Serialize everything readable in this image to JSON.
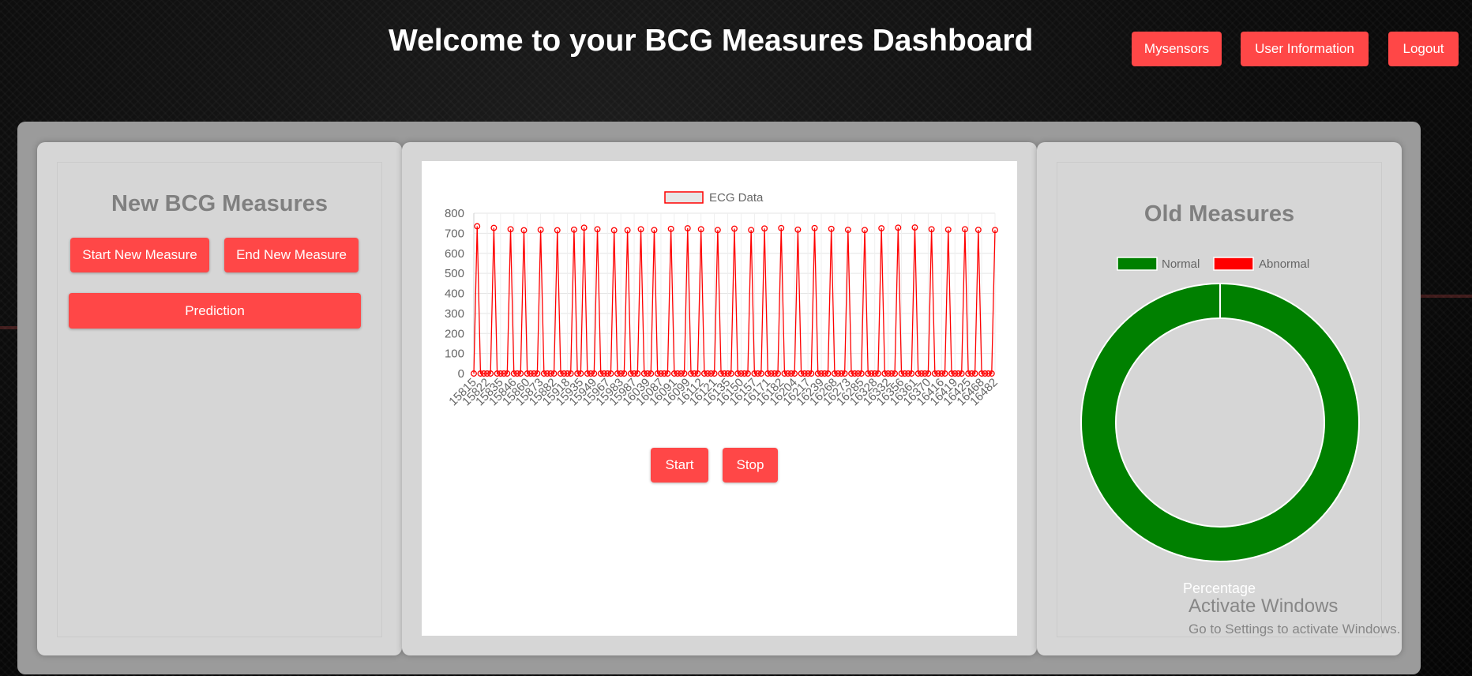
{
  "header": {
    "title": "Welcome to your BCG Measures Dashboard",
    "nav": {
      "mysensors": "Mysensors",
      "user_information": "User Information",
      "logout": "Logout"
    }
  },
  "left_panel": {
    "heading": "New BCG Measures",
    "start_label": "Start New Measure",
    "end_label": "End New Measure",
    "prediction_label": "Prediction"
  },
  "center_panel": {
    "start_label": "Start",
    "stop_label": "Stop"
  },
  "right_panel": {
    "heading": "Old Measures",
    "percentage_label": "Percentage"
  },
  "watermark": {
    "line1": "Activate Windows",
    "line2": "Go to Settings to activate Windows."
  },
  "colors": {
    "accent": "#ff4747",
    "ecg_line": "#ff0000",
    "normal": "#008000",
    "abnormal": "#ff0000"
  },
  "chart_data": [
    {
      "type": "line",
      "series": [
        {
          "name": "ECG Data",
          "values": [
            0,
            735,
            0,
            0,
            0,
            0,
            727,
            0,
            0,
            0,
            0,
            720,
            0,
            0,
            0,
            715,
            0,
            0,
            0,
            0,
            717,
            0,
            0,
            0,
            0,
            715,
            0,
            0,
            0,
            0,
            718,
            0,
            0,
            728,
            0,
            0,
            0,
            720,
            0,
            0,
            0,
            0,
            715,
            0,
            0,
            0,
            715,
            0,
            0,
            0,
            720,
            0,
            0,
            0,
            716,
            0,
            0,
            0,
            0,
            722,
            0,
            0,
            0,
            0,
            725,
            0,
            0,
            0,
            720,
            0,
            0,
            0,
            0,
            716,
            0,
            0,
            0,
            0,
            723,
            0,
            0,
            0,
            0,
            716,
            0,
            0,
            0,
            724,
            0,
            0,
            0,
            0,
            726,
            0,
            0,
            0,
            0,
            718,
            0,
            0,
            0,
            0,
            726,
            0,
            0,
            0,
            0,
            722,
            0,
            0,
            0,
            0,
            717,
            0,
            0,
            0,
            0,
            716,
            0,
            0,
            0,
            0,
            725,
            0,
            0,
            0,
            0,
            728,
            0,
            0,
            0,
            0,
            729,
            0,
            0,
            0,
            0,
            720,
            0,
            0,
            0,
            0,
            718,
            0,
            0,
            0,
            0,
            720,
            0,
            0,
            0,
            717,
            0,
            0,
            0,
            0,
            716
          ]
        }
      ],
      "x_tick_labels": [
        "15815",
        "15822",
        "15835",
        "15846",
        "15860",
        "15873",
        "15882",
        "15918",
        "15935",
        "15949",
        "15967",
        "15983",
        "15987",
        "16039",
        "16087",
        "16091",
        "16099",
        "16112",
        "16121",
        "16135",
        "16150",
        "16157",
        "16171",
        "16182",
        "16204",
        "16217",
        "16239",
        "16268",
        "16273",
        "16285",
        "16328",
        "16332",
        "16356",
        "16361",
        "16370",
        "16416",
        "16419",
        "16425",
        "16468",
        "16482"
      ],
      "ylim": [
        0,
        800
      ],
      "y_ticks": [
        0,
        100,
        200,
        300,
        400,
        500,
        600,
        700,
        800
      ],
      "grid": true,
      "legend": "top-center"
    },
    {
      "type": "pie",
      "donut": true,
      "categories": [
        "Normal",
        "Abnormal"
      ],
      "values": [
        100,
        0
      ],
      "legend": "top-center"
    }
  ]
}
